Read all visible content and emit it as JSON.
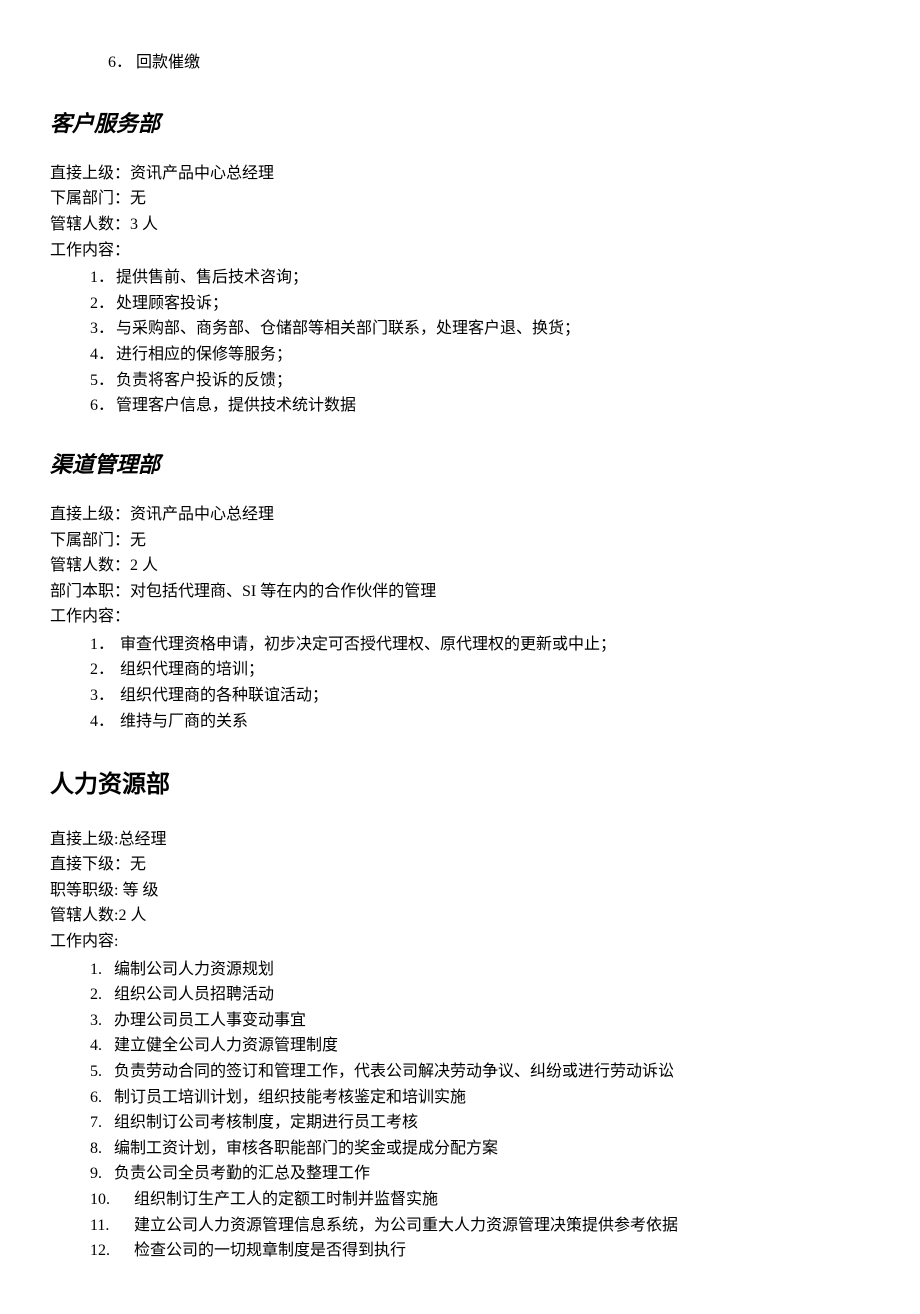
{
  "topList": {
    "items": [
      {
        "n": "6．",
        "text": "回款催缴"
      }
    ]
  },
  "section1": {
    "title": "客户服务部",
    "info": [
      "直接上级：资讯产品中心总经理",
      "下属部门：无",
      "管辖人数：3 人",
      "工作内容："
    ],
    "list": [
      {
        "n": "1．",
        "text": "提供售前、售后技术咨询；"
      },
      {
        "n": "2．",
        "text": "处理顾客投诉；"
      },
      {
        "n": "3．",
        "text": "与采购部、商务部、仓储部等相关部门联系，处理客户退、换货；"
      },
      {
        "n": "4．",
        "text": "进行相应的保修等服务；"
      },
      {
        "n": "5．",
        "text": "负责将客户投诉的反馈；"
      },
      {
        "n": "6．",
        "text": "管理客户信息，提供技术统计数据"
      }
    ]
  },
  "section2": {
    "title": "渠道管理部",
    "info": [
      "直接上级：资讯产品中心总经理",
      "下属部门：无",
      "管辖人数：2 人",
      "部门本职：对包括代理商、SI 等在内的合作伙伴的管理",
      "工作内容："
    ],
    "list": [
      {
        "n": "1．",
        "text": "审查代理资格申请，初步决定可否授代理权、原代理权的更新或中止；"
      },
      {
        "n": "2．",
        "text": "组织代理商的培训；"
      },
      {
        "n": "3．",
        "text": "组织代理商的各种联谊活动；"
      },
      {
        "n": "4．",
        "text": "维持与厂商的关系"
      }
    ]
  },
  "section3": {
    "title": "人力资源部",
    "info": [
      "直接上级:总经理",
      "直接下级：无",
      "职等职级:  等 级",
      "管辖人数:2 人",
      "工作内容:"
    ],
    "list": [
      {
        "n": "1.",
        "text": "编制公司人力资源规划",
        "wide": false
      },
      {
        "n": "2.",
        "text": "组织公司人员招聘活动",
        "wide": false
      },
      {
        "n": "3.",
        "text": "办理公司员工人事变动事宜",
        "wide": false
      },
      {
        "n": "4.",
        "text": "建立健全公司人力资源管理制度",
        "wide": false
      },
      {
        "n": "5.",
        "text": "负责劳动合同的签订和管理工作，代表公司解决劳动争议、纠纷或进行劳动诉讼",
        "wide": false
      },
      {
        "n": "6.",
        "text": "制订员工培训计划，组织技能考核鉴定和培训实施",
        "wide": false
      },
      {
        "n": "7.",
        "text": "组织制订公司考核制度，定期进行员工考核",
        "wide": false
      },
      {
        "n": "8.",
        "text": "编制工资计划，审核各职能部门的奖金或提成分配方案",
        "wide": false
      },
      {
        "n": "9.",
        "text": "负责公司全员考勤的汇总及整理工作",
        "wide": false
      },
      {
        "n": "10.",
        "text": "组织制订生产工人的定额工时制并监督实施",
        "wide": true
      },
      {
        "n": "11.",
        "text": "建立公司人力资源管理信息系统，为公司重大人力资源管理决策提供参考依据",
        "wide": true
      },
      {
        "n": "12.",
        "text": "检查公司的一切规章制度是否得到执行",
        "wide": true
      }
    ]
  }
}
